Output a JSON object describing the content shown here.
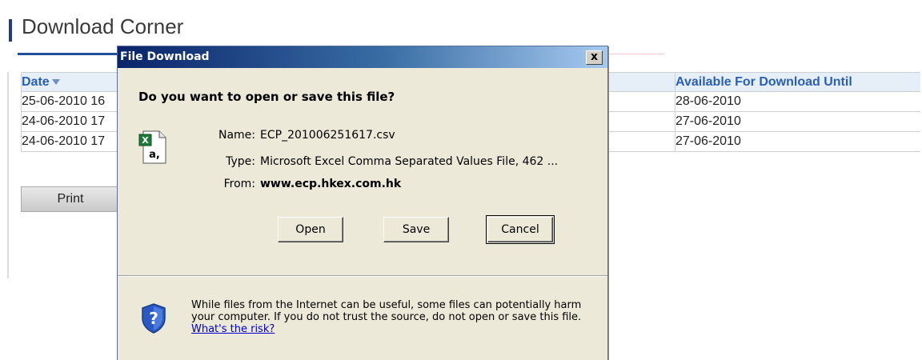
{
  "page": {
    "title": "Download Corner",
    "table": {
      "headers": {
        "date": "Date",
        "available_until": "Available For Download Until"
      },
      "rows": [
        {
          "date": "25-06-2010 16",
          "available_until": "28-06-2010"
        },
        {
          "date": "24-06-2010 17",
          "available_until": "27-06-2010"
        },
        {
          "date": "24-06-2010 17",
          "available_until": "27-06-2010"
        }
      ]
    },
    "print_label": "Print",
    "colors": {
      "header_text": "#2a5fb8",
      "header_bg": "#e6eef7",
      "accent": "#1f3c88"
    }
  },
  "dialog": {
    "title": "File Download",
    "close_glyph": "x",
    "question": "Do you want to open or save this file?",
    "name_label": "Name:",
    "name_value": "ECP_201006251617.csv",
    "type_label": "Type:",
    "type_value": "Microsoft Excel Comma Separated Values File, 462 ...",
    "from_label": "From:",
    "from_value": "www.ecp.hkex.com.hk",
    "buttons": {
      "open": "Open",
      "save": "Save",
      "cancel": "Cancel"
    },
    "warning_text": "While files from the Internet can be useful, some files can potentially harm your computer. If you do not trust the source, do not open or save this file.",
    "risk_link": "What's the risk?",
    "icon_letter": "a,",
    "colors": {
      "title_gradient_start": "#0a246a",
      "title_gradient_end": "#a6caf0",
      "body_bg": "#ece9d8"
    }
  }
}
